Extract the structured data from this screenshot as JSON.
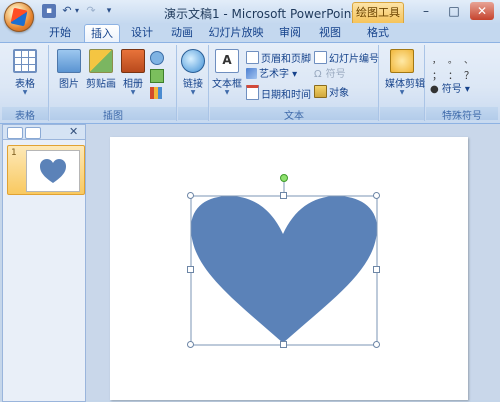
{
  "window": {
    "title": "演示文稿1 - Microsoft PowerPoint",
    "context_tab": "绘图工具"
  },
  "quick_access": {
    "undo_arrow": "▾",
    "more": "▾"
  },
  "tabs": [
    {
      "label": "开始",
      "active": false
    },
    {
      "label": "插入",
      "active": true
    },
    {
      "label": "设计",
      "active": false
    },
    {
      "label": "动画",
      "active": false
    },
    {
      "label": "幻灯片放映",
      "active": false
    },
    {
      "label": "审阅",
      "active": false
    },
    {
      "label": "视图",
      "active": false
    },
    {
      "label": "格式",
      "active": false
    }
  ],
  "ribbon": {
    "groups": {
      "tables": {
        "label": "表格",
        "table_button": "表格"
      },
      "illustrations": {
        "label": "插图",
        "picture": "图片",
        "clipart": "剪贴画",
        "album": "相册"
      },
      "links": {
        "link": "链接"
      },
      "text": {
        "label": "文本",
        "textbox": "文本框",
        "header_footer": "页眉和页脚",
        "wordart": "艺术字",
        "datetime": "日期和时间",
        "slide_number": "幻灯片编号",
        "symbol": "符号",
        "object": "对象"
      },
      "media": {
        "clips": "媒体剪辑"
      },
      "special_symbols": {
        "label": "特殊符号",
        "symbol": "符号"
      }
    }
  },
  "slides_pane": {
    "slide_number": "1"
  },
  "colors": {
    "heart_fill": "#5b82b8",
    "selection": "#7b94b5"
  }
}
